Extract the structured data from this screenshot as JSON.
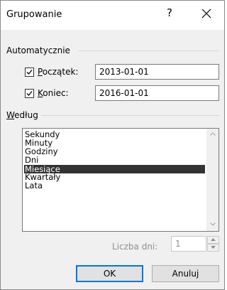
{
  "dialog": {
    "title": "Grupowanie",
    "help_glyph": "?"
  },
  "auto_group": {
    "heading": "Automatycznie",
    "start": {
      "checked": true,
      "label_prefix": "",
      "label_underline": "P",
      "label_rest": "oczątek:",
      "value": "2013-01-01"
    },
    "end": {
      "checked": true,
      "label_prefix": "",
      "label_underline": "K",
      "label_rest": "oniec:",
      "value": "2016-01-01"
    }
  },
  "by_group": {
    "heading_underline": "W",
    "heading_rest": "edług",
    "items": [
      "Sekundy",
      "Minuty",
      "Godziny",
      "Dni",
      "Miesiące",
      "Kwartały",
      "Lata"
    ],
    "selected": "Miesiące"
  },
  "days": {
    "label": "Liczba dni:",
    "value": "1"
  },
  "buttons": {
    "ok": "OK",
    "cancel": "Anuluj"
  },
  "colors": {
    "accent": "#0078d7",
    "selection": "#333333",
    "disabled_text": "#8e8e8e"
  }
}
